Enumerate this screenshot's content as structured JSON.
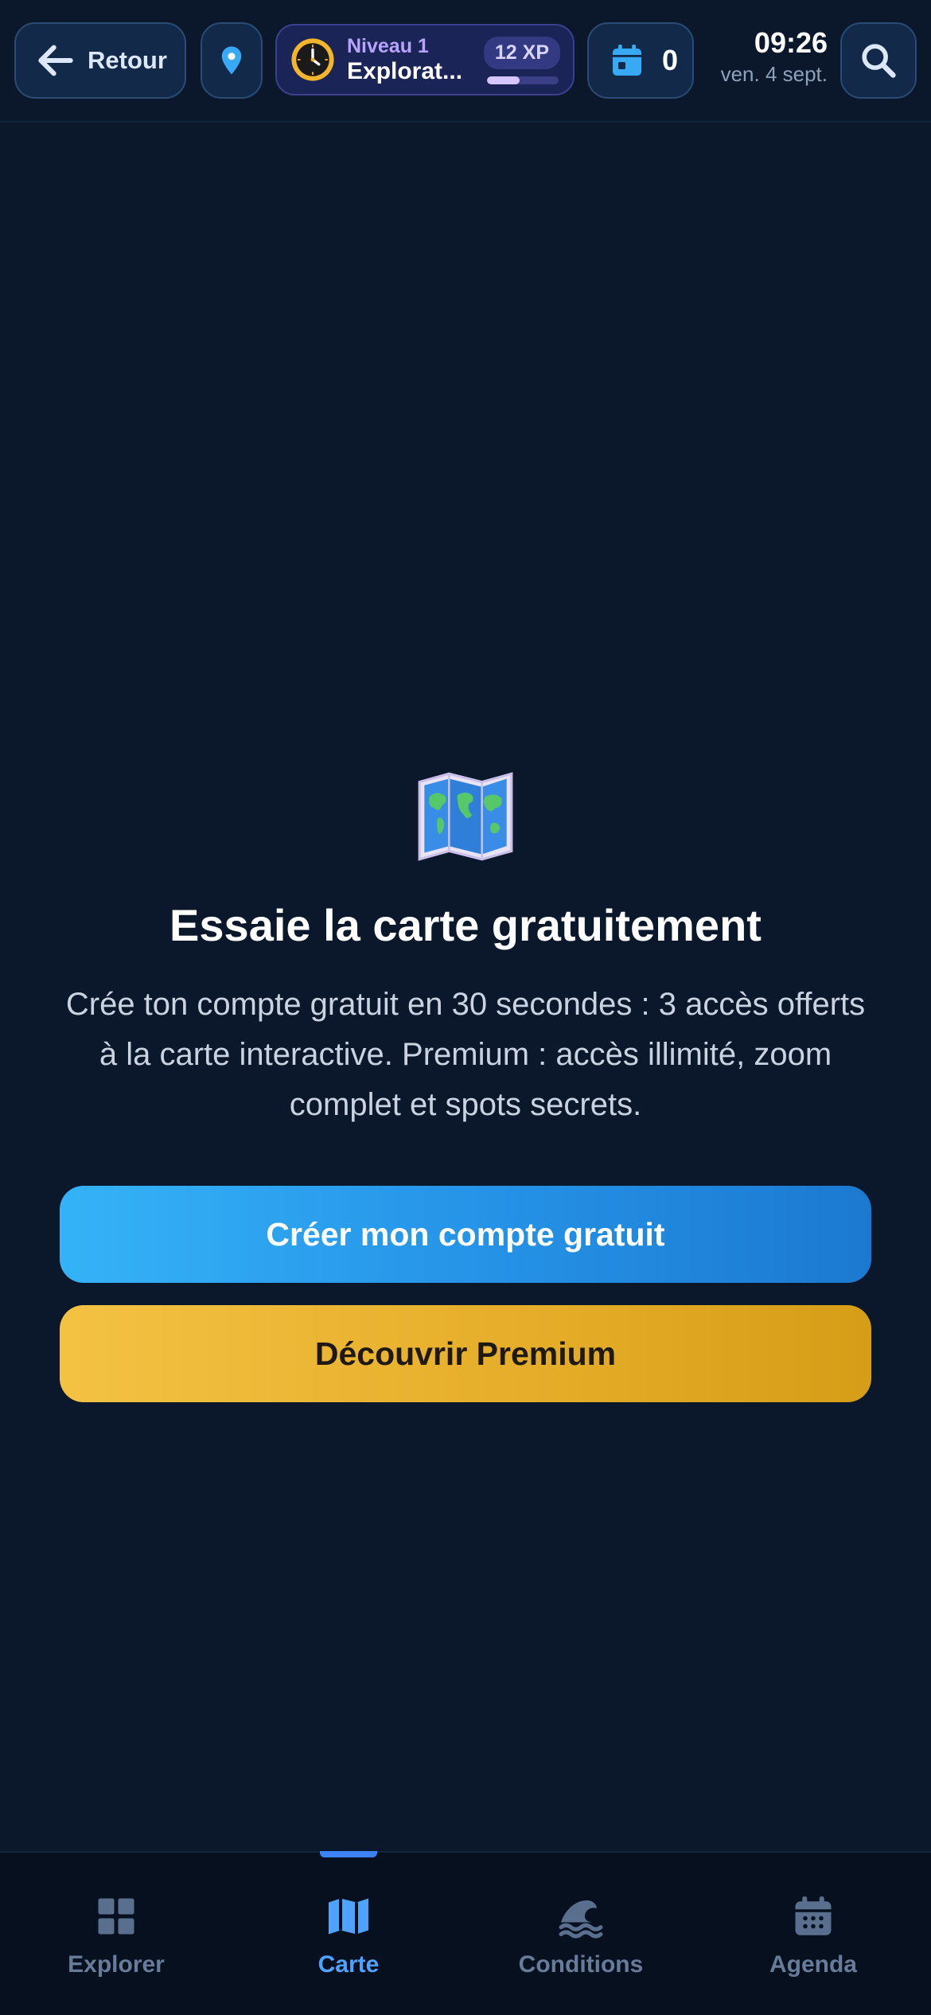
{
  "header": {
    "back_label": "Retour",
    "level_label": "Niveau 1",
    "level_title": "Explorat...",
    "xp_label": "12 XP",
    "xp_progress": 0.45,
    "agenda_count": "0",
    "time": "09:26",
    "date": "ven. 4 sept.",
    "icons": {
      "back": "arrow-left-icon",
      "location": "location-pin-icon",
      "level": "clock-icon",
      "agenda": "calendar-icon",
      "search": "search-icon"
    }
  },
  "promo": {
    "icon": "world-map-icon",
    "title": "Essaie la carte gratuitement",
    "description": "Crée ton compte gratuit en 30 secondes : 3 accès offerts à la carte interactive. Premium : accès illimité, zoom complet et spots secrets.",
    "primary_button": "Créer mon compte gratuit",
    "secondary_button": "Découvrir Premium"
  },
  "nav": {
    "active": "Carte",
    "items": [
      {
        "label": "Explorer",
        "icon": "grid-icon"
      },
      {
        "label": "Carte",
        "icon": "map-icon"
      },
      {
        "label": "Conditions",
        "icon": "wave-icon"
      },
      {
        "label": "Agenda",
        "icon": "calendar-icon"
      }
    ]
  },
  "colors": {
    "background": "#0b172a",
    "accent": "#3b82f6",
    "primary_cta": "#2694e8",
    "premium_cta": "#e6ae2a",
    "nav_inactive": "#687c99",
    "nav_active": "#4ea3ff"
  }
}
